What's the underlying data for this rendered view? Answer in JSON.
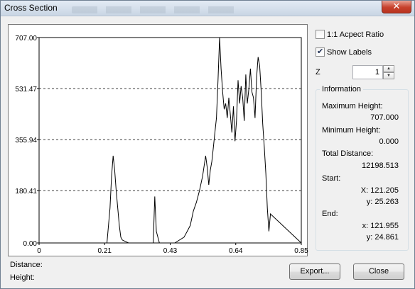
{
  "window": {
    "title": "Cross Section",
    "close_symbol": "✕"
  },
  "options": {
    "aspect_ratio_label": "1:1 Acpect Ratio",
    "aspect_ratio_checked": false,
    "show_labels_label": "Show Labels",
    "show_labels_checked": true,
    "z_label": "Z",
    "z_value": "1"
  },
  "information": {
    "title": "Information",
    "max_height_label": "Maximum Height:",
    "max_height_value": "707.000",
    "min_height_label": "Minimum Height:",
    "min_height_value": "0.000",
    "total_distance_label": "Total Distance:",
    "total_distance_value": "12198.513",
    "start_label": "Start:",
    "start_x": "X: 121.205",
    "start_y": "y: 25.263",
    "end_label": "End:",
    "end_x": "x: 121.955",
    "end_y": "y: 24.861"
  },
  "footer": {
    "distance_label": "Distance:",
    "height_label": "Height:",
    "export_label": "Export...",
    "close_label": "Close"
  },
  "chart_data": {
    "type": "line",
    "title": "",
    "xlabel": "",
    "ylabel": "",
    "xlim": [
      0,
      0.85
    ],
    "ylim": [
      0,
      707
    ],
    "x_tick_labels": [
      "0",
      "0.21",
      "0.43",
      "0.64",
      "0.85"
    ],
    "y_tick_labels": [
      "707.00",
      "531.47",
      "355.94",
      "180.41",
      "0.00"
    ],
    "y_gridlines": [
      180.41,
      355.94,
      531.47
    ],
    "grid": "horizontal dashed",
    "series": [
      {
        "color": "#000000",
        "x": [
          0,
          0.22,
          0.23,
          0.235,
          0.24,
          0.245,
          0.25,
          0.255,
          0.26,
          0.265,
          0.27,
          0.29,
          0.37,
          0.375,
          0.38,
          0.39,
          0.44,
          0.47,
          0.48,
          0.49,
          0.5,
          0.51,
          0.52,
          0.53,
          0.54,
          0.545,
          0.55,
          0.555,
          0.56,
          0.565,
          0.57,
          0.575,
          0.58,
          0.585,
          0.59,
          0.595,
          0.6,
          0.605,
          0.61,
          0.615,
          0.62,
          0.625,
          0.63,
          0.635,
          0.64,
          0.645,
          0.65,
          0.655,
          0.66,
          0.665,
          0.67,
          0.675,
          0.68,
          0.685,
          0.69,
          0.695,
          0.7,
          0.705,
          0.71,
          0.715,
          0.72,
          0.725,
          0.73,
          0.735,
          0.74,
          0.745,
          0.75,
          0.85
        ],
        "y": [
          0,
          0,
          120,
          230,
          300,
          250,
          180,
          120,
          60,
          20,
          10,
          0,
          0,
          160,
          40,
          0,
          0,
          20,
          40,
          60,
          110,
          140,
          180,
          230,
          300,
          260,
          200,
          250,
          280,
          330,
          380,
          430,
          560,
          707,
          600,
          520,
          460,
          480,
          430,
          500,
          440,
          380,
          470,
          350,
          420,
          560,
          480,
          540,
          500,
          420,
          580,
          480,
          530,
          600,
          520,
          500,
          430,
          570,
          640,
          610,
          520,
          410,
          330,
          240,
          120,
          40,
          100,
          0
        ]
      }
    ]
  }
}
